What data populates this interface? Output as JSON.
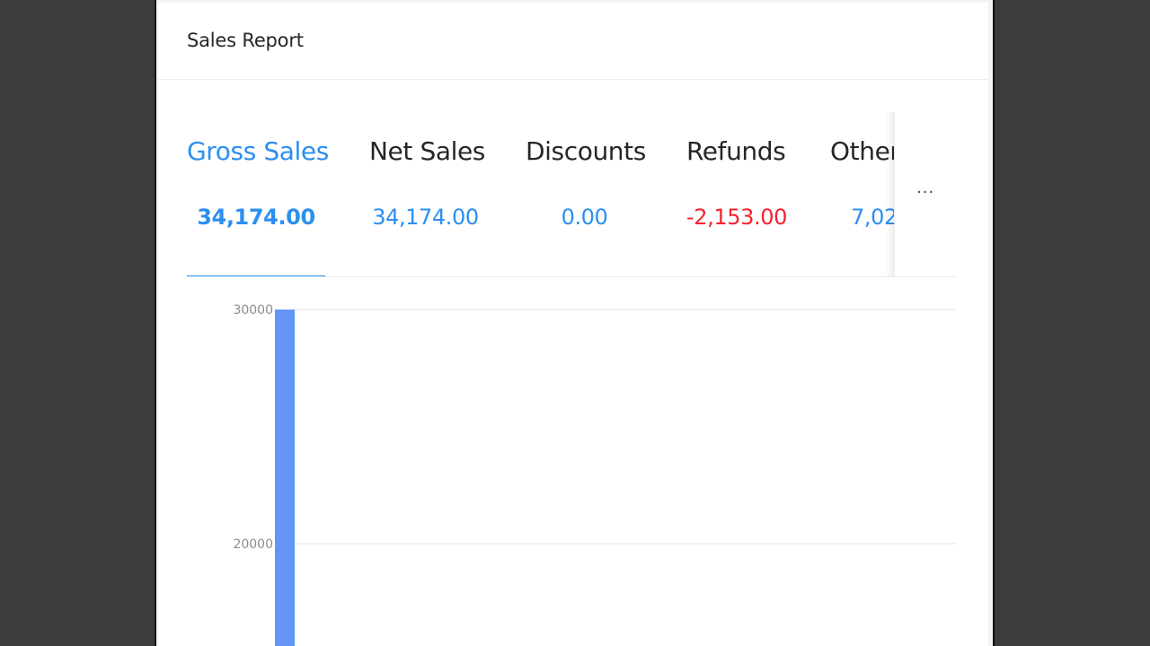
{
  "report": {
    "title": "Sales Report",
    "more_label": "..."
  },
  "tabs": [
    {
      "label": "Gross Sales",
      "value": "34,174.00",
      "value_color": "#2b8ff0",
      "active": true
    },
    {
      "label": "Net Sales",
      "value": "34,174.00",
      "value_color": "#2b8ff0",
      "active": false
    },
    {
      "label": "Discounts",
      "value": "0.00",
      "value_color": "#2b8ff0",
      "active": false
    },
    {
      "label": "Refunds",
      "value": "-2,153.00",
      "value_color": "#f5222d",
      "active": false
    },
    {
      "label": "Other",
      "value": "7,02",
      "value_color": "#2b8ff0",
      "active": false
    }
  ],
  "colors": {
    "accent": "#2b8ff0",
    "negative": "#f5222d",
    "bar": "#6495f9"
  },
  "chart_data": {
    "type": "bar",
    "series": [
      {
        "values": [
          30000
        ]
      }
    ],
    "ytick_labels": [
      "30000",
      "20000"
    ],
    "yticks": [
      30000,
      20000
    ],
    "ylim_visible": [
      17800,
      30000
    ],
    "grid": true
  }
}
